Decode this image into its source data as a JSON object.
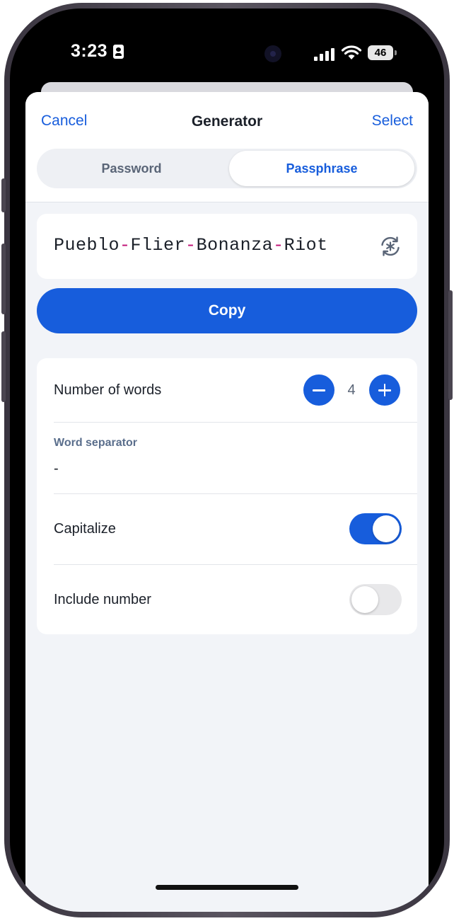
{
  "status_bar": {
    "time": "3:23",
    "battery": "46"
  },
  "header": {
    "cancel_label": "Cancel",
    "title": "Generator",
    "select_label": "Select",
    "tabs": [
      {
        "label": "Password",
        "selected": false
      },
      {
        "label": "Passphrase",
        "selected": true
      }
    ]
  },
  "passphrase": {
    "words": [
      "Pueblo",
      "Flier",
      "Bonanza",
      "Riot"
    ],
    "separator": "-",
    "separator_color": "#c01176"
  },
  "copy_label": "Copy",
  "options": {
    "number_of_words": {
      "label": "Number of words",
      "value": "4"
    },
    "word_separator": {
      "label": "Word separator",
      "value": "-"
    },
    "capitalize": {
      "label": "Capitalize",
      "on": true
    },
    "include_number": {
      "label": "Include number",
      "on": false
    }
  },
  "icons": {
    "regenerate": "regenerate-icon",
    "minus": "minus-icon",
    "plus": "plus-icon"
  },
  "colors": {
    "accent": "#175ddc",
    "background": "#f2f4f8"
  }
}
